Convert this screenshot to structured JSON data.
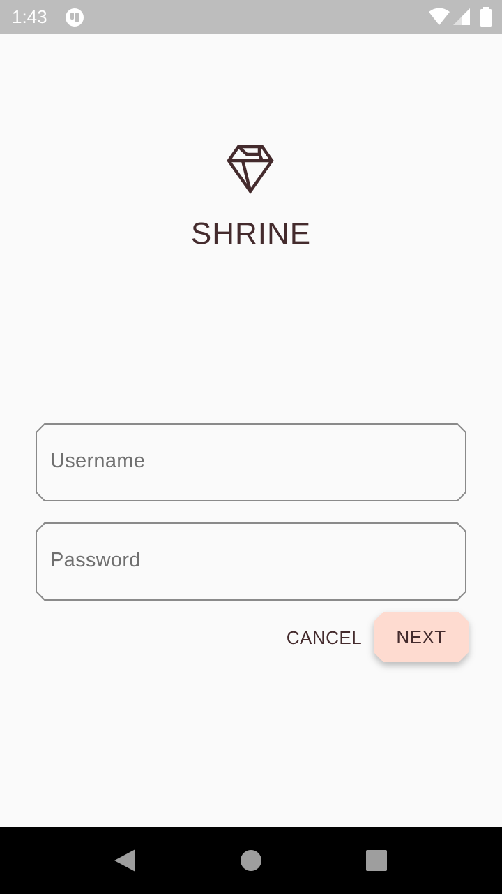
{
  "status_bar": {
    "time": "1:43",
    "app_icon": "notification-app-icon",
    "icons": [
      "wifi-icon",
      "signal-icon",
      "battery-icon"
    ]
  },
  "brand": {
    "logo_icon": "diamond-logo-icon",
    "title": "SHRINE",
    "color": "#442b2d"
  },
  "form": {
    "username": {
      "placeholder": "Username",
      "value": ""
    },
    "password": {
      "placeholder": "Password",
      "value": ""
    }
  },
  "actions": {
    "cancel_label": "CANCEL",
    "next_label": "NEXT",
    "next_background": "#fedbd0"
  },
  "nav_bar": {
    "icons": [
      "back-icon",
      "home-icon",
      "recents-icon"
    ]
  }
}
